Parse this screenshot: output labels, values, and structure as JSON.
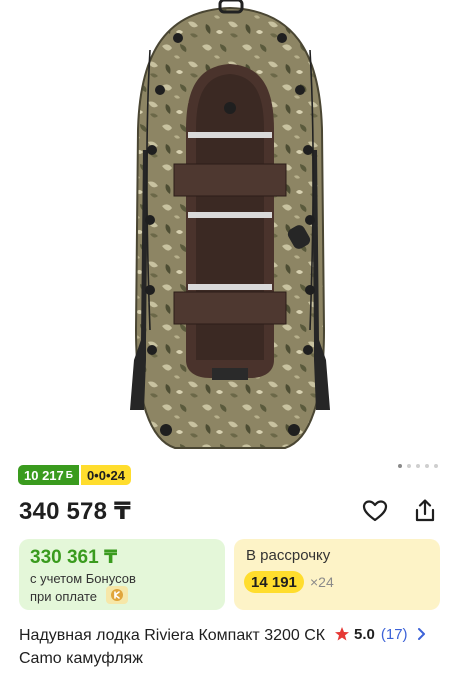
{
  "product": {
    "image_alt": "inflatable-boat-camo",
    "gallery": {
      "total": 5,
      "active_index": 0
    }
  },
  "badges": {
    "bonus_value": "10 217",
    "bonus_symbol": "Б",
    "installment_text": "0•0•24",
    "bonus_color": "#3a9b1e",
    "installment_color": "#ffdd2d"
  },
  "price": {
    "main": "340 578 ₸"
  },
  "actions": {
    "favorite_icon": "heart-icon",
    "share_icon": "share-icon"
  },
  "bonus_card": {
    "price": "330 361 ₸",
    "note_line1": "с учетом Бонусов",
    "note_line2": "при оплате"
  },
  "installment_card": {
    "label": "В рассрочку",
    "monthly": "14 191",
    "multiplier": "×24"
  },
  "title": "Надувная лодка Riviera Компакт 3200 СК Camo камуфляж",
  "rating": {
    "value": "5.0",
    "count": "(17)",
    "star_color": "#e53935",
    "link_color": "#3d63d8"
  }
}
